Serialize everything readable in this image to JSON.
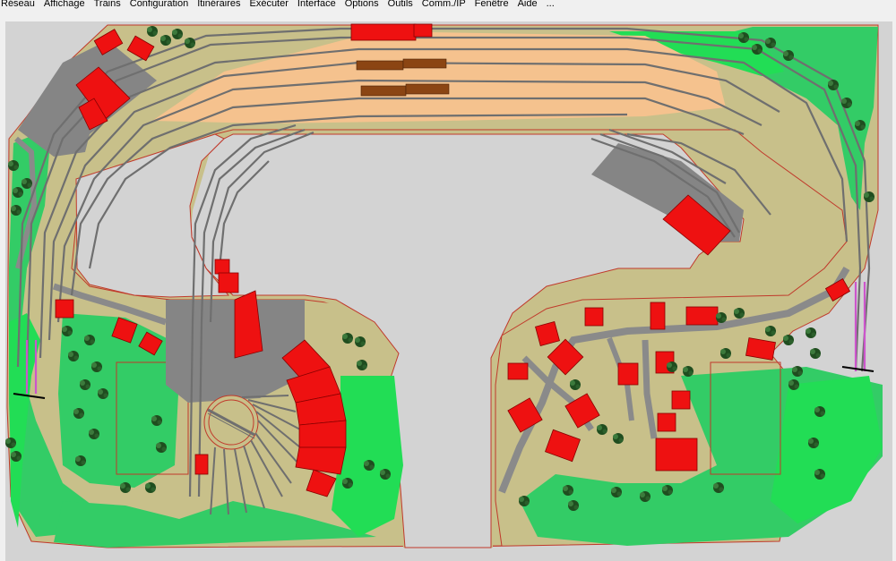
{
  "menu": {
    "items": [
      "Réseau",
      "Affichage",
      "Trains",
      "Configuration",
      "Itinéraires",
      "Exécuter",
      "Interface",
      "Options",
      "Outils",
      "Comm./IP",
      "Fenêtre",
      "Aide",
      "..."
    ]
  },
  "colors": {
    "canvas_background": "#d3d3d3",
    "baseboard_border": "#c0392b",
    "ground": "#c8c08a",
    "platform": "#f5c28e",
    "grass_light": "#33cc66",
    "grass_bright": "#22dd55",
    "road": "#8a8a8a",
    "yard_gray": "#858585",
    "building_red": "#ee1111",
    "tree_dark": "#1f4d1f",
    "rail_gray": "#6f6f6f",
    "tunnel_magenta": "#cc55cc",
    "wagon_brown": "#8b4513"
  },
  "icons": {
    "turntable": "turntable-icon",
    "roundhouse": "roundhouse-icon",
    "tree": "tree-icon",
    "house": "house-icon"
  }
}
